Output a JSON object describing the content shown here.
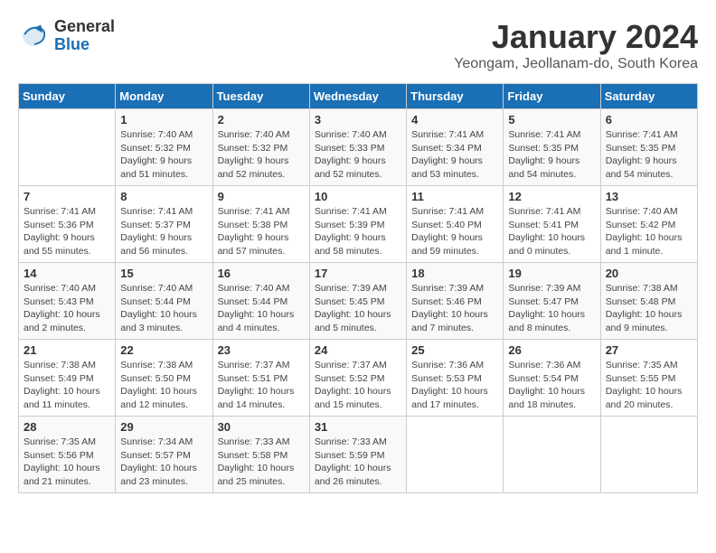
{
  "logo": {
    "text_general": "General",
    "text_blue": "Blue"
  },
  "calendar": {
    "title": "January 2024",
    "subtitle": "Yeongam, Jeollanam-do, South Korea"
  },
  "days_of_week": [
    "Sunday",
    "Monday",
    "Tuesday",
    "Wednesday",
    "Thursday",
    "Friday",
    "Saturday"
  ],
  "weeks": [
    [
      {
        "day": "",
        "info": ""
      },
      {
        "day": "1",
        "info": "Sunrise: 7:40 AM\nSunset: 5:32 PM\nDaylight: 9 hours\nand 51 minutes."
      },
      {
        "day": "2",
        "info": "Sunrise: 7:40 AM\nSunset: 5:32 PM\nDaylight: 9 hours\nand 52 minutes."
      },
      {
        "day": "3",
        "info": "Sunrise: 7:40 AM\nSunset: 5:33 PM\nDaylight: 9 hours\nand 52 minutes."
      },
      {
        "day": "4",
        "info": "Sunrise: 7:41 AM\nSunset: 5:34 PM\nDaylight: 9 hours\nand 53 minutes."
      },
      {
        "day": "5",
        "info": "Sunrise: 7:41 AM\nSunset: 5:35 PM\nDaylight: 9 hours\nand 54 minutes."
      },
      {
        "day": "6",
        "info": "Sunrise: 7:41 AM\nSunset: 5:35 PM\nDaylight: 9 hours\nand 54 minutes."
      }
    ],
    [
      {
        "day": "7",
        "info": "Sunrise: 7:41 AM\nSunset: 5:36 PM\nDaylight: 9 hours\nand 55 minutes."
      },
      {
        "day": "8",
        "info": "Sunrise: 7:41 AM\nSunset: 5:37 PM\nDaylight: 9 hours\nand 56 minutes."
      },
      {
        "day": "9",
        "info": "Sunrise: 7:41 AM\nSunset: 5:38 PM\nDaylight: 9 hours\nand 57 minutes."
      },
      {
        "day": "10",
        "info": "Sunrise: 7:41 AM\nSunset: 5:39 PM\nDaylight: 9 hours\nand 58 minutes."
      },
      {
        "day": "11",
        "info": "Sunrise: 7:41 AM\nSunset: 5:40 PM\nDaylight: 9 hours\nand 59 minutes."
      },
      {
        "day": "12",
        "info": "Sunrise: 7:41 AM\nSunset: 5:41 PM\nDaylight: 10 hours\nand 0 minutes."
      },
      {
        "day": "13",
        "info": "Sunrise: 7:40 AM\nSunset: 5:42 PM\nDaylight: 10 hours\nand 1 minute."
      }
    ],
    [
      {
        "day": "14",
        "info": "Sunrise: 7:40 AM\nSunset: 5:43 PM\nDaylight: 10 hours\nand 2 minutes."
      },
      {
        "day": "15",
        "info": "Sunrise: 7:40 AM\nSunset: 5:44 PM\nDaylight: 10 hours\nand 3 minutes."
      },
      {
        "day": "16",
        "info": "Sunrise: 7:40 AM\nSunset: 5:44 PM\nDaylight: 10 hours\nand 4 minutes."
      },
      {
        "day": "17",
        "info": "Sunrise: 7:39 AM\nSunset: 5:45 PM\nDaylight: 10 hours\nand 5 minutes."
      },
      {
        "day": "18",
        "info": "Sunrise: 7:39 AM\nSunset: 5:46 PM\nDaylight: 10 hours\nand 7 minutes."
      },
      {
        "day": "19",
        "info": "Sunrise: 7:39 AM\nSunset: 5:47 PM\nDaylight: 10 hours\nand 8 minutes."
      },
      {
        "day": "20",
        "info": "Sunrise: 7:38 AM\nSunset: 5:48 PM\nDaylight: 10 hours\nand 9 minutes."
      }
    ],
    [
      {
        "day": "21",
        "info": "Sunrise: 7:38 AM\nSunset: 5:49 PM\nDaylight: 10 hours\nand 11 minutes."
      },
      {
        "day": "22",
        "info": "Sunrise: 7:38 AM\nSunset: 5:50 PM\nDaylight: 10 hours\nand 12 minutes."
      },
      {
        "day": "23",
        "info": "Sunrise: 7:37 AM\nSunset: 5:51 PM\nDaylight: 10 hours\nand 14 minutes."
      },
      {
        "day": "24",
        "info": "Sunrise: 7:37 AM\nSunset: 5:52 PM\nDaylight: 10 hours\nand 15 minutes."
      },
      {
        "day": "25",
        "info": "Sunrise: 7:36 AM\nSunset: 5:53 PM\nDaylight: 10 hours\nand 17 minutes."
      },
      {
        "day": "26",
        "info": "Sunrise: 7:36 AM\nSunset: 5:54 PM\nDaylight: 10 hours\nand 18 minutes."
      },
      {
        "day": "27",
        "info": "Sunrise: 7:35 AM\nSunset: 5:55 PM\nDaylight: 10 hours\nand 20 minutes."
      }
    ],
    [
      {
        "day": "28",
        "info": "Sunrise: 7:35 AM\nSunset: 5:56 PM\nDaylight: 10 hours\nand 21 minutes."
      },
      {
        "day": "29",
        "info": "Sunrise: 7:34 AM\nSunset: 5:57 PM\nDaylight: 10 hours\nand 23 minutes."
      },
      {
        "day": "30",
        "info": "Sunrise: 7:33 AM\nSunset: 5:58 PM\nDaylight: 10 hours\nand 25 minutes."
      },
      {
        "day": "31",
        "info": "Sunrise: 7:33 AM\nSunset: 5:59 PM\nDaylight: 10 hours\nand 26 minutes."
      },
      {
        "day": "",
        "info": ""
      },
      {
        "day": "",
        "info": ""
      },
      {
        "day": "",
        "info": ""
      }
    ]
  ]
}
